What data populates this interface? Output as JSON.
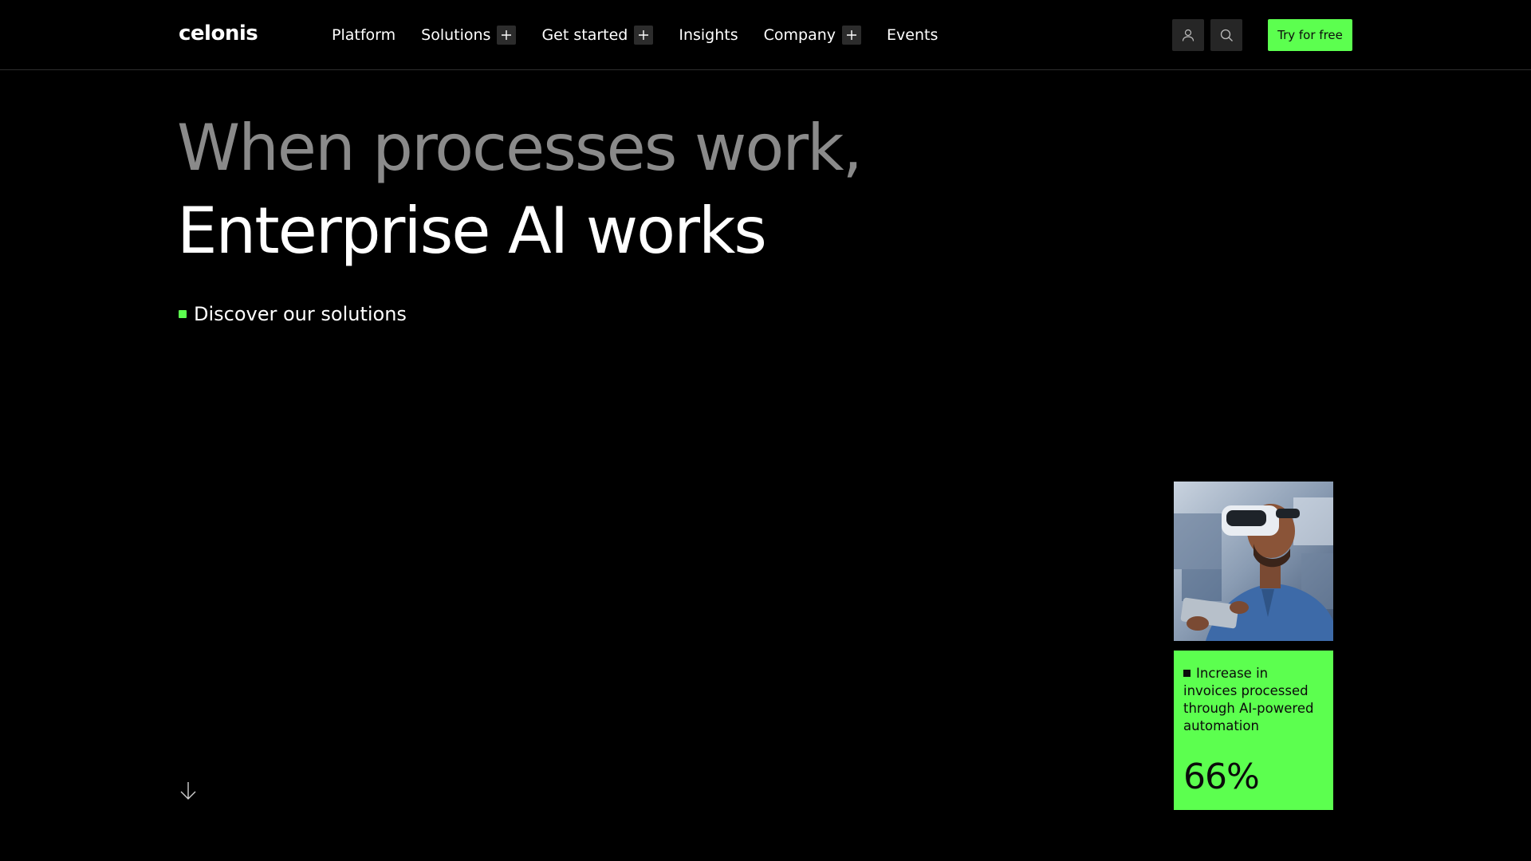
{
  "header": {
    "logo": "celonis",
    "nav": [
      {
        "label": "Platform",
        "expandable": false
      },
      {
        "label": "Solutions",
        "expandable": true
      },
      {
        "label": "Get started",
        "expandable": true
      },
      {
        "label": "Insights",
        "expandable": false
      },
      {
        "label": "Company",
        "expandable": true
      },
      {
        "label": "Events",
        "expandable": false
      }
    ],
    "account_icon": "user-icon",
    "search_icon": "search-icon",
    "cta_label": "Try for free"
  },
  "hero": {
    "line1": "When processes work,",
    "line2": "Enterprise AI works",
    "discover_label": "Discover our solutions",
    "scroll_icon": "arrow-down-icon"
  },
  "stat": {
    "description": "Increase in invoices processed through AI-powered automation",
    "value": "66%"
  },
  "colors": {
    "accent": "#5cff4f",
    "background": "#000000",
    "headline_muted": "#8a8a8a"
  }
}
